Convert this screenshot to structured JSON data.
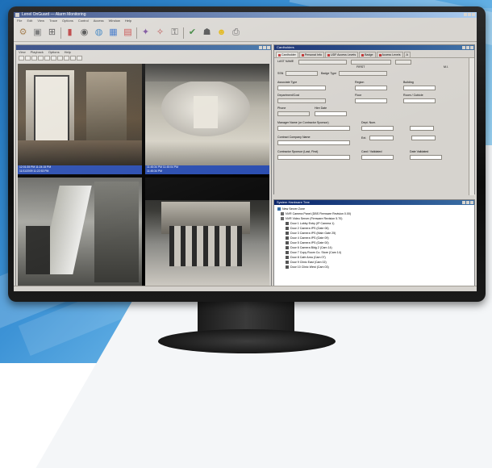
{
  "app": {
    "title": "Lenel OnGuard — Alarm Monitoring",
    "menus": [
      "File",
      "Edit",
      "View",
      "Trace",
      "Options",
      "Control",
      "Access",
      "Window",
      "Help"
    ]
  },
  "toolbar_icons": [
    "tool-icon",
    "monitor-icon",
    "split-icon",
    "door-icon",
    "camera-icon",
    "globe-icon",
    "chart-icon",
    "report-icon",
    "alarm-icon",
    "video-icon",
    "lock-icon",
    "check-icon",
    "badge-icon",
    "smiley-icon",
    "print-icon"
  ],
  "video_window": {
    "title": "",
    "menus": [
      "View",
      "Playback",
      "Options",
      "Help"
    ],
    "cameras": [
      {
        "caption_a": "12:01:35 PM  11:24:15 PM",
        "caption_b": "11/11/2009  11:22:53 PM"
      },
      {
        "caption_a": "11:45:34 PM  11:45:04 PM",
        "caption_b": "11:45:34 PM"
      },
      {
        "caption_a": "",
        "caption_b": ""
      },
      {
        "caption_a": "",
        "caption_b": ""
      }
    ]
  },
  "badge_window": {
    "title": "Cardholders",
    "tabs": [
      "Cardholder",
      "Personal Info",
      "UDF Access Levels",
      "Badge",
      "Access Levels",
      "A"
    ],
    "fields": {
      "last_name": "LAST NAME",
      "first": "FIRST",
      "mi": "M.I.",
      "ssn": "SSN",
      "badge_type": "Badge Type",
      "user_type": "Associate Type",
      "region": "Region",
      "building": "Building",
      "department": "Department/Cost",
      "floor": "Floor",
      "room": "Room / Cubicle",
      "phone": "Phone",
      "hire_date": "Hire Date",
      "manager": "Manager Name (or Contractor Sponsor)",
      "dept_num": "Dept. Num.",
      "contract_company": "Contract Company Name",
      "ext": "Ext.",
      "sponsor": "Contractor Sponsor (Last, First)",
      "card": "Card / Validated",
      "date_validated": "Date Validated"
    }
  },
  "hardware_window": {
    "title": "System Hardware Tree",
    "items": [
      "New Server Zone",
      "NVR Camera Panel (DBS Firmware Revision 0.00)",
      "NVR Video Server (Firmware Revision 5.70)",
      "Door 1 Lobby Entry (IP Camera 1)",
      "Door 2 Camera IPS (Gate 06)",
      "Door 3 Camera IPS (Main Gate 25)",
      "Door 4 Camera IPS (Gate 09)",
      "Door 5 Camera IPS (Gate 00)",
      "Door 6 Camera Bldg 2 (Cam 14)",
      "Door 7 Copy Room Co. Store (Cam 14)",
      "Door 8 Cafe Area (Cam 07)",
      "Door 9 Clinic East (Cam 02)",
      "Door 10 Clinic West (Cam 03)"
    ]
  },
  "colors": {
    "titlebar": "#0a246a",
    "camera_caption": "#2a4db0",
    "window_face": "#d6d3ce",
    "background_blue": "#2a7fc7"
  }
}
